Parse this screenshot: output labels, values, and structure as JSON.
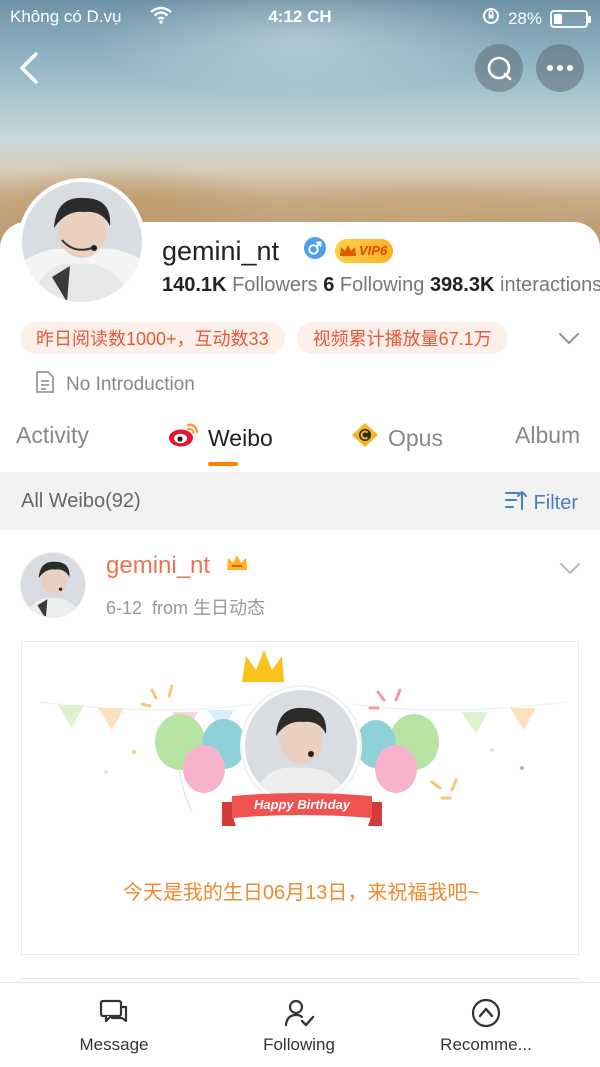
{
  "status_bar": {
    "carrier": "Không có D.vụ",
    "time": "4:12 CH",
    "battery": "28%",
    "battery_level": 0.28
  },
  "header": {
    "back_icon": "chevron-left-icon",
    "search_icon": "search-icon",
    "more_icon": "more-dots-icon"
  },
  "profile": {
    "username": "gemini_nt",
    "gender_icon": "male-icon",
    "vip_label": "VIP6",
    "followers_count": "140.1K",
    "followers_label": "Followers",
    "following_count": "6",
    "following_label": "Following",
    "interactions_count": "398.3K",
    "interactions_label": "interactions",
    "tags": [
      "昨日阅读数1000+，互动数33",
      "视频累计播放量67.1万"
    ],
    "intro": "No Introduction"
  },
  "tabs": [
    {
      "label": "Activity",
      "active": false
    },
    {
      "label": "Weibo",
      "active": true
    },
    {
      "label": "Opus",
      "active": false
    },
    {
      "label": "Album",
      "active": false
    }
  ],
  "filter_bar": {
    "all_label": "All Weibo(92)",
    "filter_label": "Filter"
  },
  "post": {
    "author": "gemini_nt",
    "date": "6-12",
    "source": "from 生日动态",
    "banner_text": "Happy Birthday",
    "text": "今天是我的生日06月13日，来祝福我吧~"
  },
  "bottom_bar": [
    {
      "label": "Message",
      "icon": "message-icon"
    },
    {
      "label": "Following",
      "icon": "user-check-icon"
    },
    {
      "label": "Recomme...",
      "icon": "compass-icon"
    }
  ],
  "colors": {
    "accent": "#ff8200",
    "username_orange": "#eb7350",
    "tag_text": "#e5593a",
    "tag_bg": "#fdf0ea",
    "filter_blue": "#4a7ec0",
    "card_text": "#f08a2c"
  }
}
